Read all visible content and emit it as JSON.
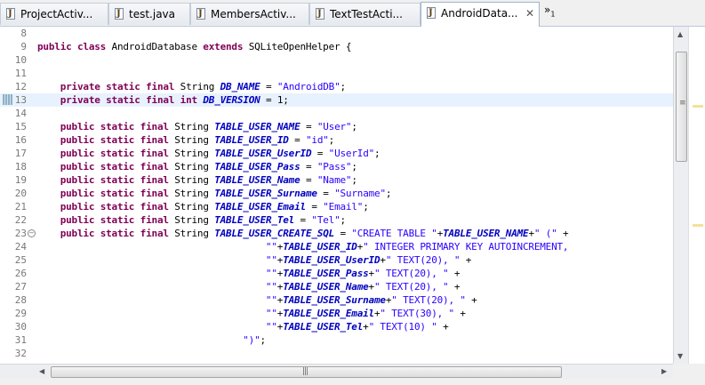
{
  "tabs": [
    {
      "label": "ProjectActiv...",
      "active": false
    },
    {
      "label": "test.java",
      "active": false
    },
    {
      "label": "MembersActiv...",
      "active": false
    },
    {
      "label": "TextTestActi...",
      "active": false
    },
    {
      "label": "AndroidData...",
      "active": true
    }
  ],
  "close_symbol": "✕",
  "overflow": {
    "symbol": "»",
    "count": "1"
  },
  "editor": {
    "current_line": "13",
    "lines": [
      {
        "num": "8",
        "tokens": []
      },
      {
        "num": "9",
        "tokens": [
          {
            "t": "kw",
            "v": "public"
          },
          {
            "t": "p",
            "v": " "
          },
          {
            "t": "kw",
            "v": "class"
          },
          {
            "t": "p",
            "v": " AndroidDatabase "
          },
          {
            "t": "kw",
            "v": "extends"
          },
          {
            "t": "p",
            "v": " SQLiteOpenHelper {"
          }
        ]
      },
      {
        "num": "10",
        "tokens": []
      },
      {
        "num": "11",
        "tokens": []
      },
      {
        "num": "12",
        "tokens": [
          {
            "t": "p",
            "v": "    "
          },
          {
            "t": "kw",
            "v": "private"
          },
          {
            "t": "p",
            "v": " "
          },
          {
            "t": "kw",
            "v": "static"
          },
          {
            "t": "p",
            "v": " "
          },
          {
            "t": "kw",
            "v": "final"
          },
          {
            "t": "p",
            "v": " String "
          },
          {
            "t": "fld",
            "v": "DB_NAME"
          },
          {
            "t": "p",
            "v": " = "
          },
          {
            "t": "str",
            "v": "\"AndroidDB\""
          },
          {
            "t": "p",
            "v": ";"
          }
        ]
      },
      {
        "num": "13",
        "tokens": [
          {
            "t": "p",
            "v": "    "
          },
          {
            "t": "kw",
            "v": "private"
          },
          {
            "t": "p",
            "v": " "
          },
          {
            "t": "kw",
            "v": "static"
          },
          {
            "t": "p",
            "v": " "
          },
          {
            "t": "kw",
            "v": "final"
          },
          {
            "t": "p",
            "v": " "
          },
          {
            "t": "kw",
            "v": "int"
          },
          {
            "t": "p",
            "v": " "
          },
          {
            "t": "fld",
            "v": "DB_VERSION"
          },
          {
            "t": "p",
            "v": " = 1;"
          }
        ]
      },
      {
        "num": "14",
        "tokens": []
      },
      {
        "num": "15",
        "tokens": [
          {
            "t": "p",
            "v": "    "
          },
          {
            "t": "kw",
            "v": "public"
          },
          {
            "t": "p",
            "v": " "
          },
          {
            "t": "kw",
            "v": "static"
          },
          {
            "t": "p",
            "v": " "
          },
          {
            "t": "kw",
            "v": "final"
          },
          {
            "t": "p",
            "v": " String "
          },
          {
            "t": "fld",
            "v": "TABLE_USER_NAME"
          },
          {
            "t": "p",
            "v": " = "
          },
          {
            "t": "str",
            "v": "\"User\""
          },
          {
            "t": "p",
            "v": ";"
          }
        ]
      },
      {
        "num": "16",
        "tokens": [
          {
            "t": "p",
            "v": "    "
          },
          {
            "t": "kw",
            "v": "public"
          },
          {
            "t": "p",
            "v": " "
          },
          {
            "t": "kw",
            "v": "static"
          },
          {
            "t": "p",
            "v": " "
          },
          {
            "t": "kw",
            "v": "final"
          },
          {
            "t": "p",
            "v": " String "
          },
          {
            "t": "fld",
            "v": "TABLE_USER_ID"
          },
          {
            "t": "p",
            "v": " = "
          },
          {
            "t": "str",
            "v": "\"id\""
          },
          {
            "t": "p",
            "v": ";"
          }
        ]
      },
      {
        "num": "17",
        "tokens": [
          {
            "t": "p",
            "v": "    "
          },
          {
            "t": "kw",
            "v": "public"
          },
          {
            "t": "p",
            "v": " "
          },
          {
            "t": "kw",
            "v": "static"
          },
          {
            "t": "p",
            "v": " "
          },
          {
            "t": "kw",
            "v": "final"
          },
          {
            "t": "p",
            "v": " String "
          },
          {
            "t": "fld",
            "v": "TABLE_USER_UserID"
          },
          {
            "t": "p",
            "v": " = "
          },
          {
            "t": "str",
            "v": "\"UserId\""
          },
          {
            "t": "p",
            "v": ";"
          }
        ]
      },
      {
        "num": "18",
        "tokens": [
          {
            "t": "p",
            "v": "    "
          },
          {
            "t": "kw",
            "v": "public"
          },
          {
            "t": "p",
            "v": " "
          },
          {
            "t": "kw",
            "v": "static"
          },
          {
            "t": "p",
            "v": " "
          },
          {
            "t": "kw",
            "v": "final"
          },
          {
            "t": "p",
            "v": " String "
          },
          {
            "t": "fld",
            "v": "TABLE_USER_Pass"
          },
          {
            "t": "p",
            "v": " = "
          },
          {
            "t": "str",
            "v": "\"Pass\""
          },
          {
            "t": "p",
            "v": ";"
          }
        ]
      },
      {
        "num": "19",
        "tokens": [
          {
            "t": "p",
            "v": "    "
          },
          {
            "t": "kw",
            "v": "public"
          },
          {
            "t": "p",
            "v": " "
          },
          {
            "t": "kw",
            "v": "static"
          },
          {
            "t": "p",
            "v": " "
          },
          {
            "t": "kw",
            "v": "final"
          },
          {
            "t": "p",
            "v": " String "
          },
          {
            "t": "fld",
            "v": "TABLE_USER_Name"
          },
          {
            "t": "p",
            "v": " = "
          },
          {
            "t": "str",
            "v": "\"Name\""
          },
          {
            "t": "p",
            "v": ";"
          }
        ]
      },
      {
        "num": "20",
        "tokens": [
          {
            "t": "p",
            "v": "    "
          },
          {
            "t": "kw",
            "v": "public"
          },
          {
            "t": "p",
            "v": " "
          },
          {
            "t": "kw",
            "v": "static"
          },
          {
            "t": "p",
            "v": " "
          },
          {
            "t": "kw",
            "v": "final"
          },
          {
            "t": "p",
            "v": " String "
          },
          {
            "t": "fld",
            "v": "TABLE_USER_Surname"
          },
          {
            "t": "p",
            "v": " = "
          },
          {
            "t": "str",
            "v": "\"Surname\""
          },
          {
            "t": "p",
            "v": ";"
          }
        ]
      },
      {
        "num": "21",
        "tokens": [
          {
            "t": "p",
            "v": "    "
          },
          {
            "t": "kw",
            "v": "public"
          },
          {
            "t": "p",
            "v": " "
          },
          {
            "t": "kw",
            "v": "static"
          },
          {
            "t": "p",
            "v": " "
          },
          {
            "t": "kw",
            "v": "final"
          },
          {
            "t": "p",
            "v": " String "
          },
          {
            "t": "fld",
            "v": "TABLE_USER_Email"
          },
          {
            "t": "p",
            "v": " = "
          },
          {
            "t": "str",
            "v": "\"Email\""
          },
          {
            "t": "p",
            "v": ";"
          }
        ]
      },
      {
        "num": "22",
        "tokens": [
          {
            "t": "p",
            "v": "    "
          },
          {
            "t": "kw",
            "v": "public"
          },
          {
            "t": "p",
            "v": " "
          },
          {
            "t": "kw",
            "v": "static"
          },
          {
            "t": "p",
            "v": " "
          },
          {
            "t": "kw",
            "v": "final"
          },
          {
            "t": "p",
            "v": " String "
          },
          {
            "t": "fld",
            "v": "TABLE_USER_Tel"
          },
          {
            "t": "p",
            "v": " = "
          },
          {
            "t": "str",
            "v": "\"Tel\""
          },
          {
            "t": "p",
            "v": ";"
          }
        ]
      },
      {
        "num": "23",
        "fold": true,
        "tokens": [
          {
            "t": "p",
            "v": "    "
          },
          {
            "t": "kw",
            "v": "public"
          },
          {
            "t": "p",
            "v": " "
          },
          {
            "t": "kw",
            "v": "static"
          },
          {
            "t": "p",
            "v": " "
          },
          {
            "t": "kw",
            "v": "final"
          },
          {
            "t": "p",
            "v": " String "
          },
          {
            "t": "fld",
            "v": "TABLE_USER_CREATE_SQL"
          },
          {
            "t": "p",
            "v": " = "
          },
          {
            "t": "str",
            "v": "\"CREATE TABLE \""
          },
          {
            "t": "p",
            "v": "+"
          },
          {
            "t": "fld",
            "v": "TABLE_USER_NAME"
          },
          {
            "t": "p",
            "v": "+"
          },
          {
            "t": "str",
            "v": "\" (\""
          },
          {
            "t": "p",
            "v": " +"
          }
        ]
      },
      {
        "num": "24",
        "tokens": [
          {
            "t": "p",
            "v": "                                        "
          },
          {
            "t": "str",
            "v": "\"\""
          },
          {
            "t": "p",
            "v": "+"
          },
          {
            "t": "fld",
            "v": "TABLE_USER_ID"
          },
          {
            "t": "p",
            "v": "+"
          },
          {
            "t": "str",
            "v": "\" INTEGER PRIMARY KEY AUTOINCREMENT,"
          }
        ]
      },
      {
        "num": "25",
        "tokens": [
          {
            "t": "p",
            "v": "                                        "
          },
          {
            "t": "str",
            "v": "\"\""
          },
          {
            "t": "p",
            "v": "+"
          },
          {
            "t": "fld",
            "v": "TABLE_USER_UserID"
          },
          {
            "t": "p",
            "v": "+"
          },
          {
            "t": "str",
            "v": "\" TEXT(20), \""
          },
          {
            "t": "p",
            "v": " +"
          }
        ]
      },
      {
        "num": "26",
        "tokens": [
          {
            "t": "p",
            "v": "                                        "
          },
          {
            "t": "str",
            "v": "\"\""
          },
          {
            "t": "p",
            "v": "+"
          },
          {
            "t": "fld",
            "v": "TABLE_USER_Pass"
          },
          {
            "t": "p",
            "v": "+"
          },
          {
            "t": "str",
            "v": "\" TEXT(20), \""
          },
          {
            "t": "p",
            "v": " +"
          }
        ]
      },
      {
        "num": "27",
        "tokens": [
          {
            "t": "p",
            "v": "                                        "
          },
          {
            "t": "str",
            "v": "\"\""
          },
          {
            "t": "p",
            "v": "+"
          },
          {
            "t": "fld",
            "v": "TABLE_USER_Name"
          },
          {
            "t": "p",
            "v": "+"
          },
          {
            "t": "str",
            "v": "\" TEXT(20), \""
          },
          {
            "t": "p",
            "v": " +"
          }
        ]
      },
      {
        "num": "28",
        "tokens": [
          {
            "t": "p",
            "v": "                                        "
          },
          {
            "t": "str",
            "v": "\"\""
          },
          {
            "t": "p",
            "v": "+"
          },
          {
            "t": "fld",
            "v": "TABLE_USER_Surname"
          },
          {
            "t": "p",
            "v": "+"
          },
          {
            "t": "str",
            "v": "\" TEXT(20), \""
          },
          {
            "t": "p",
            "v": " +"
          }
        ]
      },
      {
        "num": "29",
        "tokens": [
          {
            "t": "p",
            "v": "                                        "
          },
          {
            "t": "str",
            "v": "\"\""
          },
          {
            "t": "p",
            "v": "+"
          },
          {
            "t": "fld",
            "v": "TABLE_USER_Email"
          },
          {
            "t": "p",
            "v": "+"
          },
          {
            "t": "str",
            "v": "\" TEXT(30), \""
          },
          {
            "t": "p",
            "v": " +"
          }
        ]
      },
      {
        "num": "30",
        "tokens": [
          {
            "t": "p",
            "v": "                                        "
          },
          {
            "t": "str",
            "v": "\"\""
          },
          {
            "t": "p",
            "v": "+"
          },
          {
            "t": "fld",
            "v": "TABLE_USER_Tel"
          },
          {
            "t": "p",
            "v": "+"
          },
          {
            "t": "str",
            "v": "\" TEXT(10) \""
          },
          {
            "t": "p",
            "v": " +"
          }
        ]
      },
      {
        "num": "31",
        "tokens": [
          {
            "t": "p",
            "v": "                                    "
          },
          {
            "t": "str",
            "v": "\")\""
          },
          {
            "t": "p",
            "v": ";"
          }
        ]
      },
      {
        "num": "32",
        "tokens": []
      }
    ]
  },
  "colors": {
    "keyword": "#7f0055",
    "field": "#0000c0",
    "string": "#2a00ff",
    "current_line": "#e8f2fe"
  }
}
